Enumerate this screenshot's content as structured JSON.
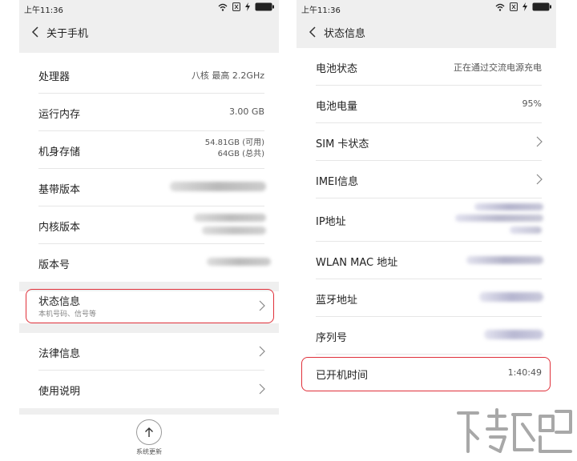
{
  "left_screen": {
    "status_bar": {
      "time": "上午11:36"
    },
    "nav": {
      "title": "关于手机"
    },
    "rows": [
      {
        "label": "处理器",
        "value": "八核 最高 2.2GHz"
      },
      {
        "label": "运行内存",
        "value": "3.00 GB"
      },
      {
        "label": "机身存储",
        "value_line1": "54.81GB (可用)",
        "value_line2": "64GB (总共)"
      },
      {
        "label": "基带版本",
        "value": ""
      },
      {
        "label": "内核版本",
        "value": ""
      },
      {
        "label": "版本号",
        "value": ""
      },
      {
        "label": "状态信息",
        "sublabel": "本机号码、信号等"
      },
      {
        "label": "法律信息"
      },
      {
        "label": "使用说明"
      }
    ],
    "system_update_label": "系统更新"
  },
  "right_screen": {
    "status_bar": {
      "time": "上午11:36"
    },
    "nav": {
      "title": "状态信息"
    },
    "rows": [
      {
        "label": "电池状态",
        "value": "正在通过交流电源充电"
      },
      {
        "label": "电池电量",
        "value": "95%"
      },
      {
        "label": "SIM 卡状态"
      },
      {
        "label": "IMEI信息"
      },
      {
        "label": "IP地址"
      },
      {
        "label": "WLAN MAC 地址"
      },
      {
        "label": "蓝牙地址"
      },
      {
        "label": "序列号"
      },
      {
        "label": "已开机时间",
        "value": "1:40:49"
      }
    ]
  },
  "colors": {
    "highlight": "#e0303a",
    "background": "#efefef"
  },
  "icons": [
    "back-arrow-icon",
    "wifi-icon",
    "sim-off-icon",
    "charging-icon",
    "battery-icon",
    "chevron-right-icon",
    "arrow-up-icon"
  ]
}
